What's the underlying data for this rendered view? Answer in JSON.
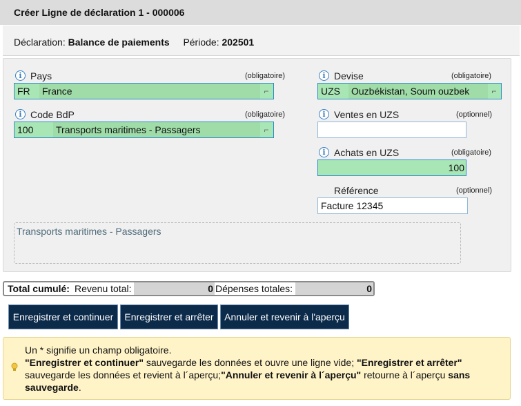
{
  "title": "Créer Ligne de déclaration 1 - 000006",
  "header": {
    "declaration_label": "Déclaration:",
    "declaration_value": "Balance de paiements",
    "periode_label": "Période:",
    "periode_value": "202501"
  },
  "form": {
    "pays": {
      "label": "Pays",
      "status": "(obligatoire)",
      "code": "FR",
      "name": "France"
    },
    "devise": {
      "label": "Devise",
      "status": "(obligatoire)",
      "code": "UZS",
      "name": "Ouzbékistan, Soum ouzbek"
    },
    "code_bdp": {
      "label": "Code BdP",
      "status": "(obligatoire)",
      "code": "100",
      "name": "Transports maritimes - Passagers"
    },
    "ventes": {
      "label": "Ventes en UZS",
      "status": "(optionnel)",
      "value": ""
    },
    "achats": {
      "label": "Achats en UZS",
      "status": "(obligatoire)",
      "value": "100"
    },
    "reference": {
      "label": "Référence",
      "status": "(optionnel)",
      "value": "Facture 12345"
    },
    "description": "Transports maritimes - Passagers",
    "info_icon_glyph": "i",
    "lookup_icon_glyph": "⌐"
  },
  "totals": {
    "label": "Total cumulé:",
    "revenu_label": "Revenu total:",
    "revenu_value": "0",
    "depenses_label": "Dépenses totales:",
    "depenses_value": "0"
  },
  "buttons": {
    "save_continue": "Enregistrer et continuer",
    "save_stop": "Enregistrer et arrêter",
    "cancel": "Annuler et revenir à l'aperçu"
  },
  "help": {
    "line1": "Un * signifie un champ obligatoire.",
    "p1_bold": "\"Enregistrer et continuer\"",
    "p1_text": " sauvegarde les données et ouvre une ligne vide; ",
    "p2_bold": "\"Enregistrer et arrêter\"",
    "p2_text": " sauvegarde les données et revient à l´aperçu;",
    "p3_bold": "\"Annuler et revenir à l´aperçu\"",
    "p3_text": " retourne à l´aperçu ",
    "p4_bold": "sans sauvegarde",
    "p4_text": "."
  },
  "colors": {
    "title_bg": "#dcdcdc",
    "field_green": "#a9e6b5",
    "button_bg": "#0c2a4a",
    "help_bg": "#fff3c8",
    "info_blue": "#3a7fc0"
  }
}
